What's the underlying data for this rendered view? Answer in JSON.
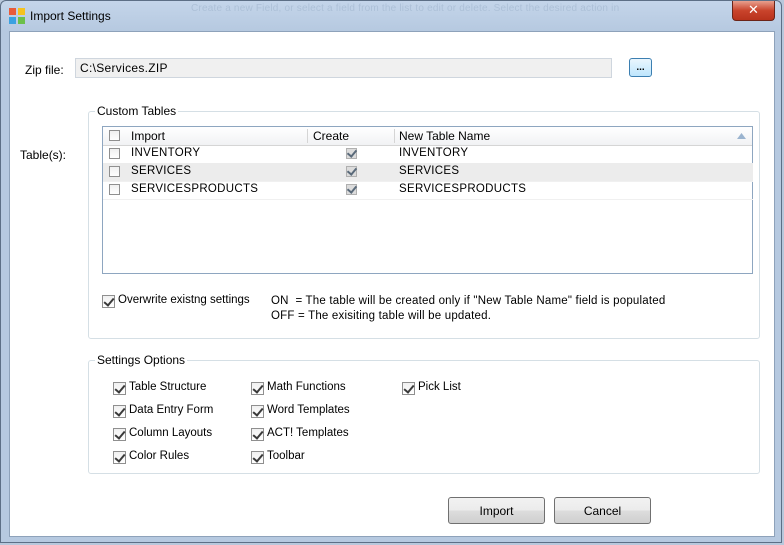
{
  "window": {
    "title": "Import Settings",
    "background_text": "Create a new Field, or select a field from the list to edit or delete. Select the desired action in",
    "close_label": "✕"
  },
  "zip": {
    "label": "Zip file:",
    "value": "C:\\Services.ZIP",
    "browse_label": "..."
  },
  "tables": {
    "side_label": "Table(s):",
    "group_title": "Custom Tables",
    "columns": [
      "Import",
      "Create",
      "New Table Name"
    ],
    "rows": [
      {
        "import_checked": false,
        "name": "INVENTORY",
        "create": true,
        "new_name": "INVENTORY"
      },
      {
        "import_checked": false,
        "name": "SERVICES",
        "create": true,
        "new_name": "SERVICES"
      },
      {
        "import_checked": false,
        "name": "SERVICESPRODUCTS",
        "create": true,
        "new_name": "SERVICESPRODUCTS"
      }
    ],
    "overwrite_label": "Overwrite existng settings",
    "overwrite_checked": true,
    "note_on": "ON  = The table will be created only if \"New Table Name\" field is populated",
    "note_off": "OFF = The exisiting table will be updated."
  },
  "settings": {
    "group_title": "Settings Options",
    "options": [
      {
        "label": "Table Structure",
        "checked": true
      },
      {
        "label": "Data Entry Form",
        "checked": true
      },
      {
        "label": "Column Layouts",
        "checked": true
      },
      {
        "label": "Color Rules",
        "checked": true
      },
      {
        "label": "Math Functions",
        "checked": true
      },
      {
        "label": "Word Templates",
        "checked": true
      },
      {
        "label": "ACT! Templates",
        "checked": true
      },
      {
        "label": "Toolbar",
        "checked": true
      },
      {
        "label": "Pick List",
        "checked": true
      }
    ]
  },
  "buttons": {
    "import": "Import",
    "cancel": "Cancel"
  },
  "colors": {
    "titlebar": "#b6c9e0",
    "close": "#c9442c"
  }
}
